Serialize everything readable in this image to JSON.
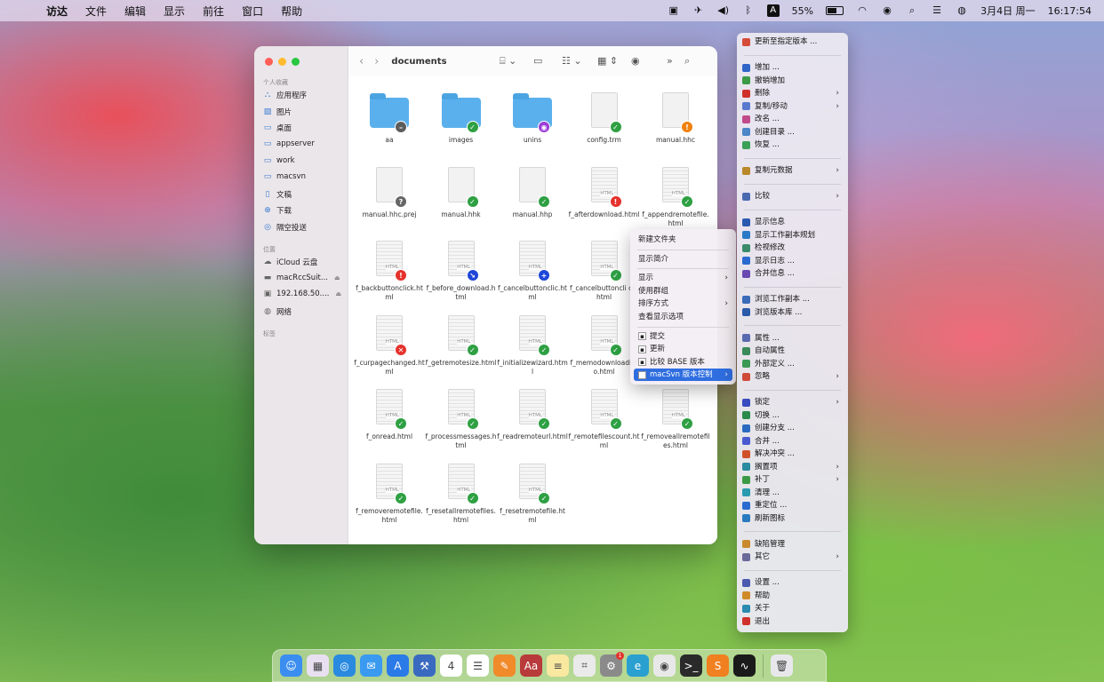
{
  "menubar": {
    "apple": "",
    "items": [
      "访达",
      "文件",
      "编辑",
      "显示",
      "前往",
      "窗口",
      "帮助"
    ],
    "battery": "55%",
    "ahk": "A",
    "date": "3月4日 周一",
    "time": "16:17:54"
  },
  "finder": {
    "title": "documents",
    "sidebar": {
      "favorites_header": "个人收藏",
      "favorites": [
        {
          "label": "应用程序",
          "icon": "apps-icon"
        },
        {
          "label": "图片",
          "icon": "photos-icon"
        },
        {
          "label": "桌面",
          "icon": "desktop-icon"
        },
        {
          "label": "appserver",
          "icon": "folder-icon"
        },
        {
          "label": "work",
          "icon": "folder-icon"
        },
        {
          "label": "macsvn",
          "icon": "folder-icon"
        },
        {
          "label": "文稿",
          "icon": "doc-icon"
        },
        {
          "label": "下载",
          "icon": "download-icon"
        },
        {
          "label": "隔空投送",
          "icon": "airdrop-icon"
        }
      ],
      "locations_header": "位置",
      "locations": [
        {
          "label": "iCloud 云盘",
          "icon": "cloud-icon"
        },
        {
          "label": "macRccSuit...",
          "icon": "disk-icon"
        },
        {
          "label": "192.168.50....",
          "icon": "server-icon"
        },
        {
          "label": "网络",
          "icon": "network-icon"
        }
      ],
      "tags_header": "标签"
    },
    "files": [
      {
        "name": "aa",
        "type": "folder",
        "badge": "minus"
      },
      {
        "name": "images",
        "type": "folder",
        "badge": "ok"
      },
      {
        "name": "unins",
        "type": "folder",
        "badge": "lock"
      },
      {
        "name": "config.trm",
        "type": "doc",
        "badge": "ok"
      },
      {
        "name": "manual.hhc",
        "type": "doc",
        "badge": "warn"
      },
      {
        "name": "manual.hhc.prej",
        "type": "doc",
        "badge": "q"
      },
      {
        "name": "manual.hhk",
        "type": "doc",
        "badge": "ok"
      },
      {
        "name": "manual.hhp",
        "type": "doc",
        "badge": "ok"
      },
      {
        "name": "f_afterdownload.html",
        "type": "html",
        "badge": "err"
      },
      {
        "name": "f_appendremotefile.html",
        "type": "html",
        "badge": "ok"
      },
      {
        "name": "f_backbuttonclick.html",
        "type": "html",
        "badge": "err"
      },
      {
        "name": "f_before_download.html",
        "type": "html",
        "badge": "arr"
      },
      {
        "name": "f_cancelbuttonclic.html",
        "type": "html",
        "badge": "add"
      },
      {
        "name": "f_cancelbuttoncli ck.html",
        "type": "html",
        "badge": "ok"
      },
      {
        "name": "",
        "type": "none",
        "badge": ""
      },
      {
        "name": "f_curpagechanged.html",
        "type": "html",
        "badge": "x"
      },
      {
        "name": "f_getremotesize.html",
        "type": "html",
        "badge": "ok"
      },
      {
        "name": "f_initializewizard.html",
        "type": "html",
        "badge": "ok"
      },
      {
        "name": "f_memodownloadinfo.html",
        "type": "html",
        "badge": "ok"
      },
      {
        "name": "",
        "type": "none",
        "badge": ""
      },
      {
        "name": "f_onread.html",
        "type": "html",
        "badge": "ok"
      },
      {
        "name": "f_processmessages.html",
        "type": "html",
        "badge": "ok"
      },
      {
        "name": "f_readremoteurl.html",
        "type": "html",
        "badge": "ok"
      },
      {
        "name": "f_remotefilescount.html",
        "type": "html",
        "badge": "ok"
      },
      {
        "name": "f_removeallremotefiles.html",
        "type": "html",
        "badge": "ok"
      },
      {
        "name": "f_removeremotefile.html",
        "type": "html",
        "badge": "ok"
      },
      {
        "name": "f_resetallremotefiles.html",
        "type": "html",
        "badge": "ok"
      },
      {
        "name": "f_resetremotefile.html",
        "type": "html",
        "badge": "ok"
      }
    ],
    "html_label": "HTML"
  },
  "context_menu": [
    {
      "label": "新建文件夹"
    },
    {
      "sep": true
    },
    {
      "label": "显示简介"
    },
    {
      "sep": true
    },
    {
      "label": "显示",
      "submenu": true
    },
    {
      "label": "使用群组"
    },
    {
      "label": "排序方式",
      "submenu": true
    },
    {
      "label": "查看显示选项"
    },
    {
      "sep": true
    },
    {
      "label": "提交",
      "icon": "commit-icon"
    },
    {
      "label": "更新",
      "icon": "update-icon"
    },
    {
      "label": "比较 BASE 版本",
      "icon": "compare-icon"
    },
    {
      "label": "macSvn 版本控制",
      "icon": "macsvn-icon",
      "submenu": true,
      "highlight": true
    }
  ],
  "svn_menu": [
    {
      "label": "更新至指定版本 ...",
      "color": "#d64a3a"
    },
    {
      "sep": true
    },
    {
      "label": "增加 ...",
      "color": "#2e64c8"
    },
    {
      "label": "撤销增加",
      "color": "#3a9a46"
    },
    {
      "label": "删除",
      "color": "#d0302a",
      "submenu": true
    },
    {
      "label": "复制/移动",
      "color": "#5a7ad0",
      "submenu": true
    },
    {
      "label": "改名 ...",
      "color": "#c04a8a"
    },
    {
      "label": "创建目录 ...",
      "color": "#4a86c8"
    },
    {
      "label": "恢复 ...",
      "color": "#3aa056"
    },
    {
      "sep": true
    },
    {
      "label": "复制元数据",
      "color": "#b8882a",
      "submenu": true
    },
    {
      "sep": true
    },
    {
      "label": "比较",
      "color": "#4a6ab0",
      "submenu": true
    },
    {
      "sep": true
    },
    {
      "label": "显示信息",
      "color": "#2a5ab0"
    },
    {
      "label": "显示工作副本规划",
      "color": "#2a7ac8"
    },
    {
      "label": "检视修改",
      "color": "#3a8a6a"
    },
    {
      "label": "显示日志 ...",
      "color": "#2a6ad0"
    },
    {
      "label": "合并信息 ...",
      "color": "#6a4ab0"
    },
    {
      "sep": true
    },
    {
      "label": "浏览工作副本 ...",
      "color": "#3a6ab8"
    },
    {
      "label": "浏览版本库 ...",
      "color": "#2a5aa8"
    },
    {
      "sep": true
    },
    {
      "label": "属性 ...",
      "color": "#5a6ab0"
    },
    {
      "label": "自动属性",
      "color": "#3a8a5a"
    },
    {
      "label": "外部定义 ...",
      "color": "#3a9a56"
    },
    {
      "label": "忽略",
      "color": "#d04a3a",
      "submenu": true
    },
    {
      "sep": true
    },
    {
      "label": "锁定",
      "color": "#3a4ac0",
      "submenu": true
    },
    {
      "label": "切换 ...",
      "color": "#2a8a4a"
    },
    {
      "label": "创建分支 ...",
      "color": "#2a6ac0"
    },
    {
      "label": "合并 ...",
      "color": "#4a5ad0"
    },
    {
      "label": "解决冲突 ...",
      "color": "#d0502a"
    },
    {
      "label": "搁置项",
      "color": "#2a8aa0",
      "submenu": true
    },
    {
      "label": "补丁",
      "color": "#3a9a46",
      "submenu": true
    },
    {
      "label": "清理 ...",
      "color": "#2a9ab0"
    },
    {
      "label": "重定位 ...",
      "color": "#2a6ad0"
    },
    {
      "label": "刷新图标",
      "color": "#2a7ac0"
    },
    {
      "sep": true
    },
    {
      "label": "缺陷管理",
      "color": "#c88a2a"
    },
    {
      "label": "其它",
      "color": "#6a6a9a",
      "submenu": true
    },
    {
      "sep": true
    },
    {
      "label": "设置 ...",
      "color": "#4a5ab0"
    },
    {
      "label": "帮助",
      "color": "#d08a2a"
    },
    {
      "label": "关于",
      "color": "#2a8ab0"
    },
    {
      "label": "退出",
      "color": "#d0302a"
    }
  ],
  "dock": [
    {
      "name": "finder-icon",
      "color": "#3b8ef0",
      "glyph": "☺"
    },
    {
      "name": "launchpad-icon",
      "color": "#e8e0f0",
      "glyph": "▦"
    },
    {
      "name": "safari-icon",
      "color": "#2a8ae0",
      "glyph": "◎"
    },
    {
      "name": "mail-icon",
      "color": "#3a9af0",
      "glyph": "✉"
    },
    {
      "name": "appstore-icon",
      "color": "#2a7ae8",
      "glyph": "A"
    },
    {
      "name": "xcode-icon",
      "color": "#3a6ac0",
      "glyph": "⚒"
    },
    {
      "name": "calendar-icon",
      "color": "#ffffff",
      "glyph": "4"
    },
    {
      "name": "reminders-icon",
      "color": "#ffffff",
      "glyph": "☰"
    },
    {
      "name": "pages-icon",
      "color": "#f08a2a",
      "glyph": "✎"
    },
    {
      "name": "dictionary-icon",
      "color": "#b83a3a",
      "glyph": "Aa"
    },
    {
      "name": "notes-icon",
      "color": "#f8e8a0",
      "glyph": "≡"
    },
    {
      "name": "screenshot-icon",
      "color": "#eaeaea",
      "glyph": "⌗"
    },
    {
      "name": "system-settings-icon",
      "color": "#8a8a8a",
      "glyph": "⚙",
      "badge": "1"
    },
    {
      "name": "edge-icon",
      "color": "#2aa0d0",
      "glyph": "e"
    },
    {
      "name": "chrome-icon",
      "color": "#e8e8e8",
      "glyph": "◉"
    },
    {
      "name": "terminal-icon",
      "color": "#2a2a2a",
      "glyph": ">_"
    },
    {
      "name": "sublime-icon",
      "color": "#f08020",
      "glyph": "S"
    },
    {
      "name": "activity-monitor-icon",
      "color": "#1a1a1a",
      "glyph": "∿"
    },
    {
      "name": "trash-icon",
      "color": "#e8e8ec",
      "glyph": "🗑"
    }
  ]
}
